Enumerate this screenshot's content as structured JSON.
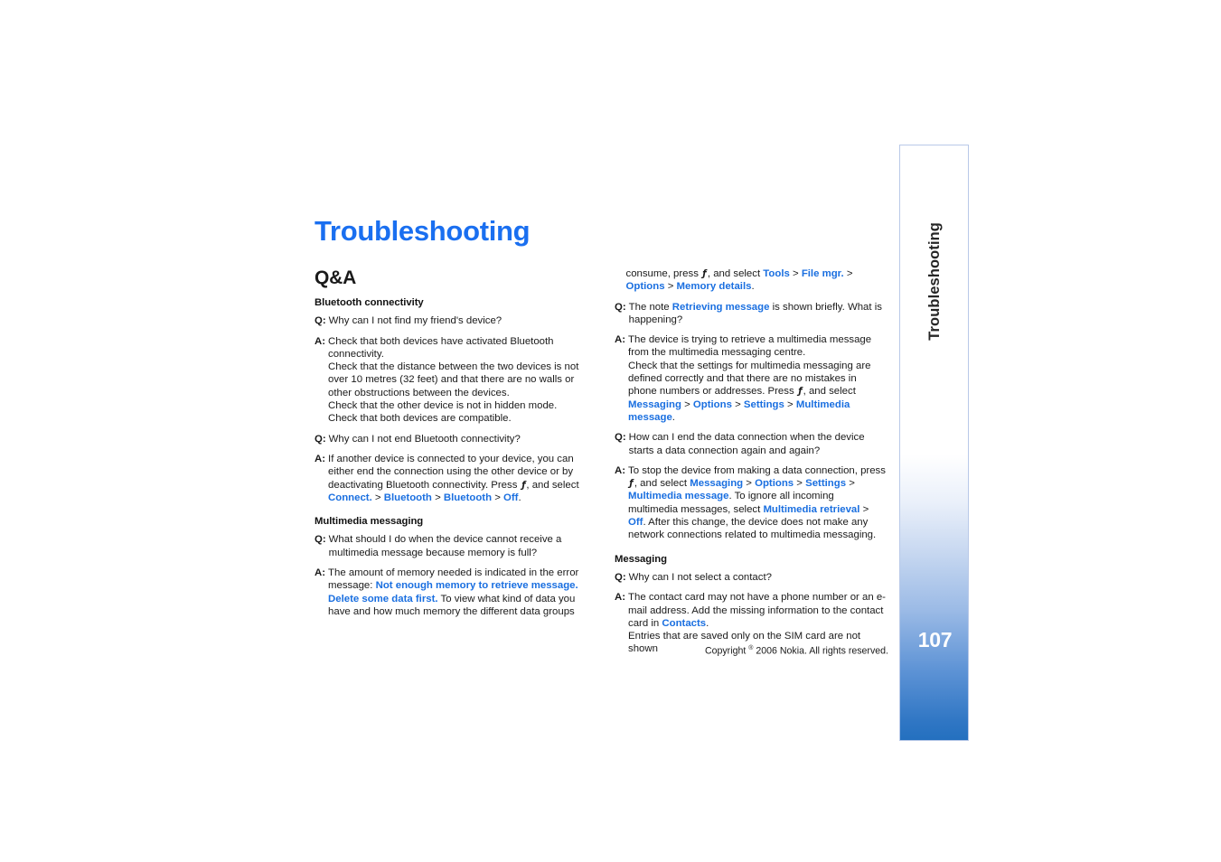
{
  "document": {
    "title": "Troubleshooting",
    "section_title": "Q&A",
    "sidebar_label": "Troubleshooting",
    "page_number": "107",
    "copyright": "Copyright ® 2006 Nokia. All rights reserved.",
    "copyright_prefix": "Copyright ",
    "copyright_mark": "®",
    "copyright_suffix": " 2006 Nokia. All rights reserved.",
    "menu_key_glyph": "ƒ"
  },
  "colors": {
    "title_blue": "#1a6ff0",
    "link_blue": "#1a6fe0",
    "sidebar_border": "#b9c9e8",
    "sidebar_gradient_end": "#2470bf",
    "body_text": "#1a1a1a"
  },
  "left_column": {
    "sections": [
      {
        "subhead": "Bluetooth connectivity",
        "items": [
          {
            "label": "Q:",
            "text": "Why can I not find my friend's device?"
          },
          {
            "label": "A:",
            "text": "Check that both devices have activated Bluetooth connectivity.",
            "text2": "Check that the distance between the two devices is not over 10 metres (32 feet) and that there are no walls or other obstructions between the devices.",
            "text3": "Check that the other device is not in hidden mode.",
            "text4": "Check that both devices are compatible."
          },
          {
            "label": "Q:",
            "text": "Why can I not end Bluetooth connectivity?"
          },
          {
            "label": "A:",
            "text_part1": "If another device is connected to your device, you can either end the connection using the other device or by deactivating Bluetooth connectivity. Press ",
            "text_part2": ", and select ",
            "link1": "Connect.",
            "link2": "Bluetooth",
            "link3": "Bluetooth",
            "link4": "Off",
            "text_end": "."
          }
        ]
      },
      {
        "subhead": "Multimedia messaging",
        "items": [
          {
            "label": "Q:",
            "text": "What should I do when the device cannot receive a multimedia message because memory is full?"
          },
          {
            "label": "A:",
            "text_part1": "The amount of memory needed is indicated in the error message: ",
            "link1": "Not enough memory to retrieve message. Delete some data first.",
            "text_part2": " To view what kind of data you have and how much memory the different data groups"
          }
        ]
      }
    ]
  },
  "right_column": {
    "continuation": {
      "text_part1": "consume, press ",
      "text_part2": ", and select ",
      "link1": "Tools",
      "link2": "File mgr.",
      "link3": "Options",
      "link4": "Memory details",
      "text_end": "."
    },
    "sections": [
      {
        "items": [
          {
            "label": "Q:",
            "text_part1": "The note ",
            "link1": "Retrieving message",
            "text_part2": " is shown briefly. What is happening?"
          },
          {
            "label": "A:",
            "text_part1": "The device is trying to retrieve a multimedia message from the multimedia messaging centre.",
            "text_part2": "Check that the settings for multimedia messaging are defined correctly and that there are no mistakes in phone numbers or addresses. Press ",
            "text_part3": ", and select ",
            "link1": "Messaging",
            "link2": "Options",
            "link3": "Settings",
            "link4": "Multimedia message",
            "text_end": "."
          },
          {
            "label": "Q:",
            "text": "How can I end the data connection when the device starts a data connection again and again?"
          },
          {
            "label": "A:",
            "text_part1": "To stop the device from making a data connection, press ",
            "text_part2": ", and select ",
            "link1": "Messaging",
            "link2": "Options",
            "link3": "Settings",
            "link4": "Multimedia message",
            "text_part3": ". To ignore all incoming multimedia messages, select ",
            "link5": "Multimedia retrieval",
            "link6": "Off",
            "text_part4": ". After this change, the device does not make any network connections related to multimedia messaging."
          }
        ]
      },
      {
        "subhead": "Messaging",
        "items": [
          {
            "label": "Q:",
            "text": "Why can I not select a contact?"
          },
          {
            "label": "A:",
            "text_part1": "The contact card may not have a phone number or an e-mail address. Add the missing information to the contact card in ",
            "link1": "Contacts",
            "text_part2": ".",
            "text_part3": "Entries that are saved only on the SIM card are not shown"
          }
        ]
      }
    ]
  }
}
